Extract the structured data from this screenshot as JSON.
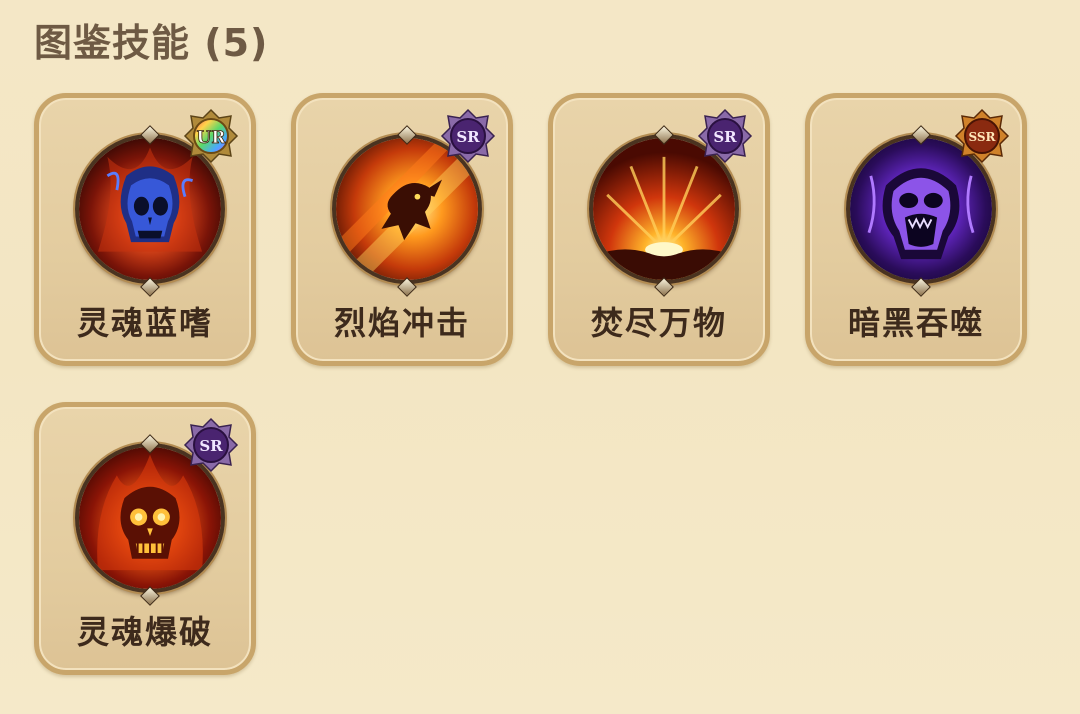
{
  "header": {
    "title": "图鉴技能 (5)"
  },
  "colors": {
    "background": "#f4e7c6",
    "card_border": "#c8a56a",
    "title_text": "#6e5a44",
    "name_text": "#3d2a1c"
  },
  "skills": [
    {
      "name": "灵魂蓝嗜",
      "rarity": "UR",
      "icon": "blue-flame-skull-icon"
    },
    {
      "name": "烈焰冲击",
      "rarity": "SR",
      "icon": "fire-dash-icon"
    },
    {
      "name": "焚尽万物",
      "rarity": "SR",
      "icon": "fire-eruption-icon"
    },
    {
      "name": "暗黑吞噬",
      "rarity": "SSR",
      "icon": "shadow-skull-icon"
    },
    {
      "name": "灵魂爆破",
      "rarity": "SR",
      "icon": "flame-skull-icon"
    }
  ]
}
